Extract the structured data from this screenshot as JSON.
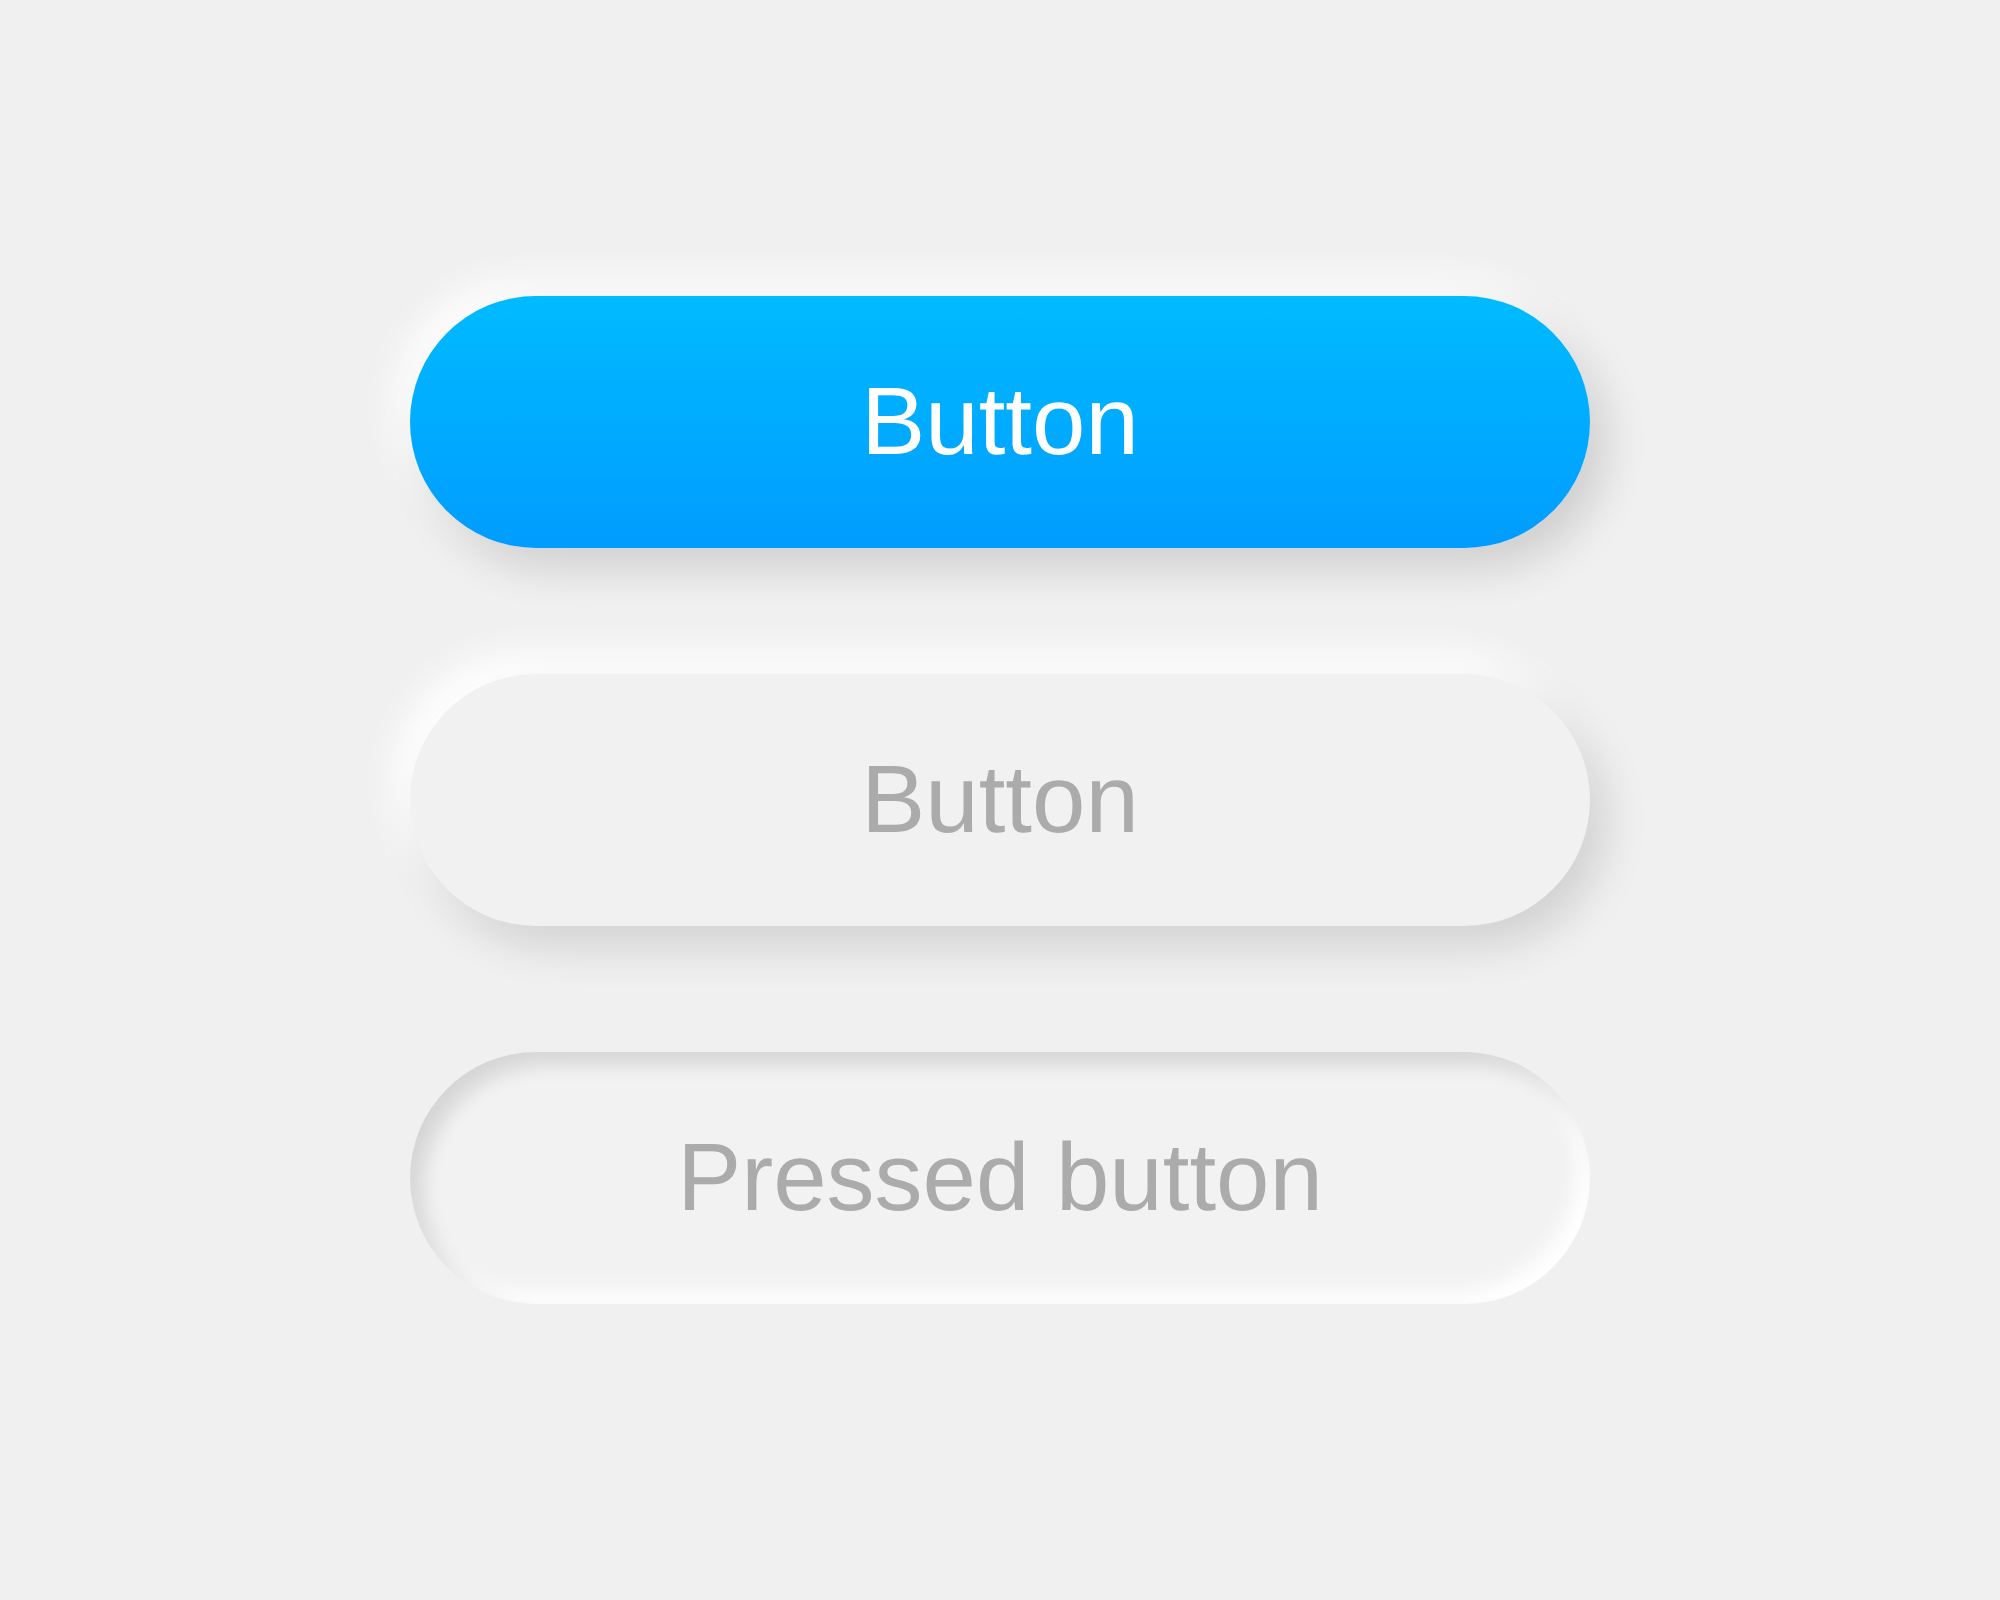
{
  "buttons": [
    {
      "label": "Button",
      "kind": "primary",
      "pressed": false
    },
    {
      "label": "Button",
      "kind": "neutral",
      "pressed": false
    },
    {
      "label": "Pressed button",
      "kind": "neutral",
      "pressed": true
    }
  ]
}
